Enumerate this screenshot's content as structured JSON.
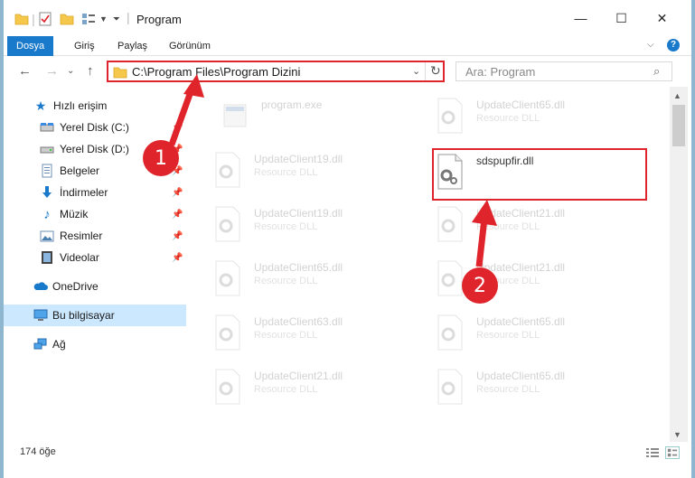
{
  "window": {
    "title": "Program",
    "minimize": "—",
    "maximize": "☐",
    "close": "✕"
  },
  "ribbon": {
    "tabs": [
      "Dosya",
      "Giriş",
      "Paylaş",
      "Görünüm"
    ],
    "help": "?"
  },
  "address": {
    "path": "C:\\Program Files\\Program Dizini",
    "search_placeholder": "Ara: Program"
  },
  "nav": {
    "quick_access": "Hızlı erişim",
    "items": [
      {
        "label": "Yerel Disk (C:)",
        "icon": "drive-icon",
        "pinned": true
      },
      {
        "label": "Yerel Disk (D:)",
        "icon": "drive-icon",
        "pinned": true
      },
      {
        "label": "Belgeler",
        "icon": "documents-icon",
        "pinned": true
      },
      {
        "label": "İndirmeler",
        "icon": "downloads-icon",
        "pinned": true
      },
      {
        "label": "Müzik",
        "icon": "music-icon",
        "pinned": true
      },
      {
        "label": "Resimler",
        "icon": "pictures-icon",
        "pinned": true
      },
      {
        "label": "Videolar",
        "icon": "videos-icon",
        "pinned": true
      }
    ],
    "onedrive": "OneDrive",
    "this_pc": "Bu bilgisayar",
    "network": "Ağ"
  },
  "files": [
    {
      "name": "program.exe",
      "type": "",
      "icon": "exe-icon"
    },
    {
      "name": "UpdateClient65.dll",
      "type": "Resource DLL",
      "icon": "dll-icon"
    },
    {
      "name": "UpdateClient19.dll",
      "type": "Resource DLL",
      "icon": "dll-icon"
    },
    {
      "name": "sdspupfir.dll",
      "type": "",
      "icon": "dll-icon"
    },
    {
      "name": "UpdateClient19.dll",
      "type": "Resource DLL",
      "icon": "dll-icon"
    },
    {
      "name": "UpdateClient21.dll",
      "type": "Resource DLL",
      "icon": "dll-icon"
    },
    {
      "name": "UpdateClient65.dll",
      "type": "Resource DLL",
      "icon": "dll-icon"
    },
    {
      "name": "UpdateClient21.dll",
      "type": "Resource DLL",
      "icon": "dll-icon"
    },
    {
      "name": "UpdateClient63.dll",
      "type": "Resource DLL",
      "icon": "dll-icon"
    },
    {
      "name": "UpdateClient65.dll",
      "type": "Resource DLL",
      "icon": "dll-icon"
    },
    {
      "name": "UpdateClient21.dll",
      "type": "Resource DLL",
      "icon": "dll-icon"
    },
    {
      "name": "UpdateClient65.dll",
      "type": "Resource DLL",
      "icon": "dll-icon"
    }
  ],
  "status": {
    "count": "174 öğe"
  },
  "annotations": {
    "step1": "1",
    "step2": "2",
    "color": "#e0242c"
  }
}
